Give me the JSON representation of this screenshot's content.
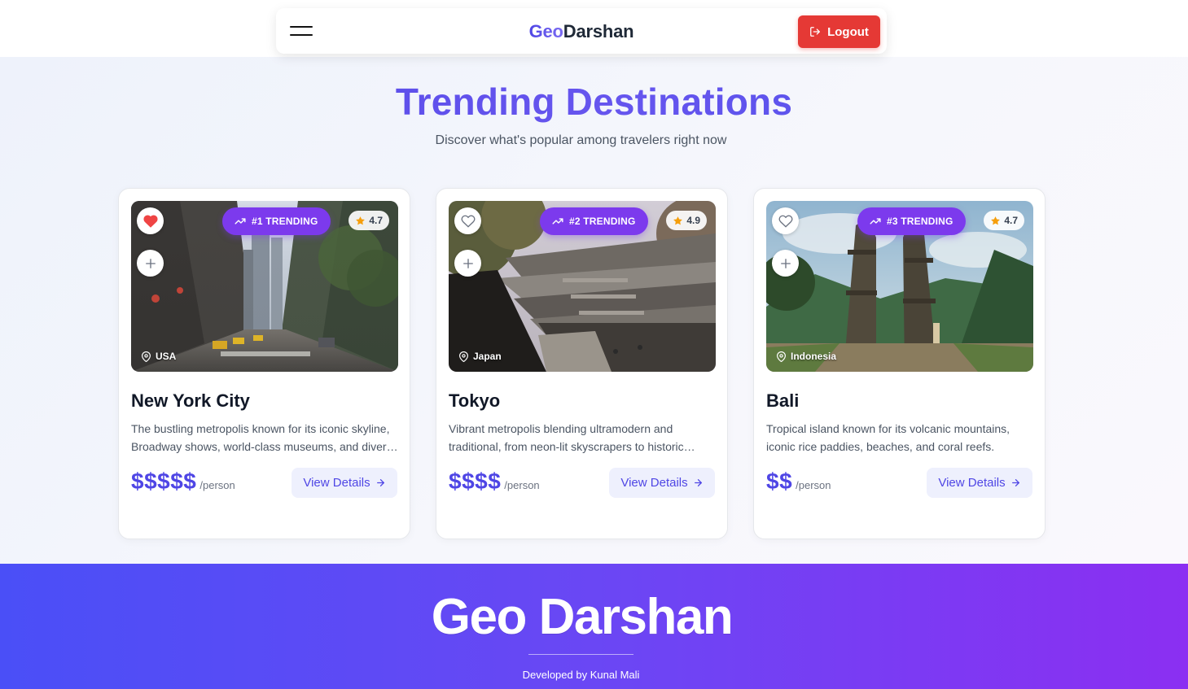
{
  "navbar": {
    "brand_part1": "Geo",
    "brand_part2": "Darshan",
    "logout_label": "Logout"
  },
  "hero": {
    "title": "Trending Destinations",
    "subtitle": "Discover what's popular among travelers right now"
  },
  "destinations": [
    {
      "badge": "#1 TRENDING",
      "rating": "4.7",
      "location": "USA",
      "name": "New York City",
      "description": "The bustling metropolis known for its iconic skyline, Broadway shows, world-class museums, and diverse neighborhoods.",
      "price": "$$$$$",
      "price_unit": "/person",
      "cta": "View Details",
      "favorited": true
    },
    {
      "badge": "#2 TRENDING",
      "rating": "4.9",
      "location": "Japan",
      "name": "Tokyo",
      "description": "Vibrant metropolis blending ultramodern and traditional, from neon-lit skyscrapers to historic temples.",
      "price": "$$$$",
      "price_unit": "/person",
      "cta": "View Details",
      "favorited": false
    },
    {
      "badge": "#3 TRENDING",
      "rating": "4.7",
      "location": "Indonesia",
      "name": "Bali",
      "description": "Tropical island known for its volcanic mountains, iconic rice paddies, beaches, and coral reefs.",
      "price": "$$",
      "price_unit": "/person",
      "cta": "View Details",
      "favorited": false
    }
  ],
  "footer": {
    "brand": "Geo Darshan",
    "credit": "Developed by Kunal Mali"
  },
  "colors": {
    "accent": "#4f46e5",
    "badge": "#7c3aed",
    "logout": "#e53935",
    "heart": "#ef4444",
    "star": "#f59e0b"
  },
  "icons": {
    "menu": "hamburger-menu-icon",
    "logout": "logout-icon",
    "trend": "trending-up-icon",
    "favorite": "heart-icon",
    "add": "plus-icon",
    "rating": "star-icon",
    "location": "map-pin-icon",
    "cta": "arrow-right-icon"
  }
}
